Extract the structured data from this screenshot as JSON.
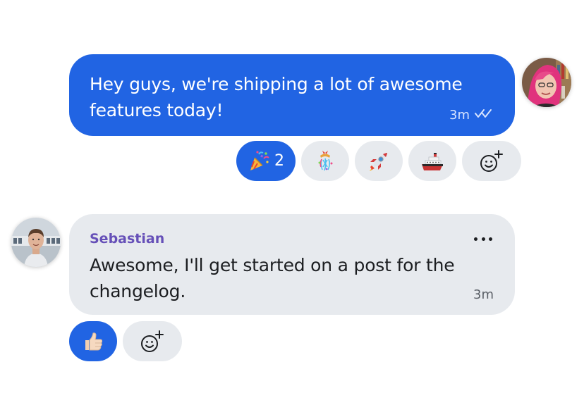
{
  "messages": [
    {
      "direction": "outgoing",
      "text": "Hey guys, we're shipping a lot of awesome features today!",
      "time": "3m",
      "status_icon": "double-check-icon",
      "reactions": [
        {
          "icon": "party-popper-icon",
          "count": "2",
          "active": true
        },
        {
          "icon": "confetti-ball-icon",
          "active": false
        },
        {
          "icon": "rocket-icon",
          "active": false
        },
        {
          "icon": "ship-icon",
          "active": false
        },
        {
          "icon": "add-reaction-icon",
          "active": false
        }
      ]
    },
    {
      "direction": "incoming",
      "sender": "Sebastian",
      "text": "Awesome, I'll get started on a post for the changelog.",
      "time": "3m",
      "menu_icon": "more-icon",
      "reactions": [
        {
          "icon": "thumbs-up-icon",
          "active": true
        },
        {
          "icon": "add-reaction-icon",
          "active": false
        }
      ]
    }
  ],
  "colors": {
    "accent": "#2164e3",
    "incoming_bubble": "#e7eaee",
    "sender_name": "#6650b8"
  }
}
